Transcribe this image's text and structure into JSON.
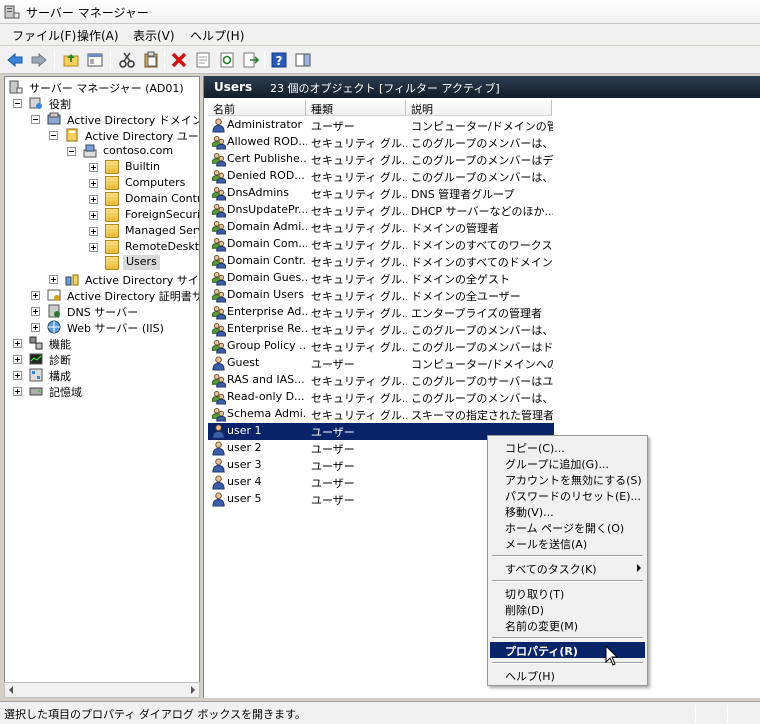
{
  "window": {
    "title": "サーバー マネージャー"
  },
  "menu": [
    {
      "label": "ファイル(F)"
    },
    {
      "label": "操作(A)"
    },
    {
      "label": "表示(V)"
    },
    {
      "label": "ヘルプ(H)"
    }
  ],
  "tree": [
    {
      "label": "サーバー マネージャー (AD01)",
      "icon": "server-manager-icon"
    },
    {
      "label": "役割",
      "icon": "roles-icon"
    },
    {
      "label": "Active Directory ドメイン サービス",
      "icon": "ad-domain-services-icon"
    },
    {
      "label": "Active Directory ユーザーとコンピューター",
      "icon": "ad-users-computers-icon"
    },
    {
      "label": "contoso.com",
      "icon": "domain-icon"
    },
    {
      "label": "Builtin",
      "icon": "folder-icon"
    },
    {
      "label": "Computers",
      "icon": "folder-icon"
    },
    {
      "label": "Domain Controllers",
      "icon": "ou-folder-icon"
    },
    {
      "label": "ForeignSecurityPrincipals",
      "icon": "folder-icon"
    },
    {
      "label": "Managed Service Accounts",
      "icon": "folder-icon"
    },
    {
      "label": "RemoteDesktop",
      "icon": "ou-folder-icon"
    },
    {
      "label": "Users",
      "icon": "folder-icon"
    },
    {
      "label": "Active Directory サイトとサービス",
      "icon": "ad-sites-icon"
    },
    {
      "label": "Active Directory 証明書サービス",
      "icon": "certificate-icon"
    },
    {
      "label": "DNS サーバー",
      "icon": "dns-icon"
    },
    {
      "label": "Web サーバー (IIS)",
      "icon": "iis-icon"
    },
    {
      "label": "機能",
      "icon": "features-icon"
    },
    {
      "label": "診断",
      "icon": "diagnostics-icon"
    },
    {
      "label": "構成",
      "icon": "configuration-icon"
    },
    {
      "label": "記憶域",
      "icon": "storage-icon"
    }
  ],
  "right": {
    "title": "Users",
    "info": "23 個のオブジェクト [フィルター アクティブ]",
    "columns": [
      "名前",
      "種類",
      "説明"
    ],
    "rows": [
      {
        "name": "Administrator",
        "type": "ユーザー",
        "desc": "コンピューター/ドメインの管...",
        "kind": "user"
      },
      {
        "name": "Allowed ROD...",
        "type": "セキュリティ グル...",
        "desc": "このグループのメンバーは、ド...",
        "kind": "group"
      },
      {
        "name": "Cert Publishe...",
        "type": "セキュリティ グル...",
        "desc": "このグループのメンバーはディ...",
        "kind": "group"
      },
      {
        "name": "Denied ROD...",
        "type": "セキュリティ グル...",
        "desc": "このグループのメンバーは、ド...",
        "kind": "group"
      },
      {
        "name": "DnsAdmins",
        "type": "セキュリティ グル...",
        "desc": "DNS 管理者グループ",
        "kind": "group"
      },
      {
        "name": "DnsUpdatePr...",
        "type": "セキュリティ グル...",
        "desc": "DHCP サーバーなどのほか...",
        "kind": "group"
      },
      {
        "name": "Domain Admi...",
        "type": "セキュリティ グル...",
        "desc": "ドメインの管理者",
        "kind": "group"
      },
      {
        "name": "Domain Com...",
        "type": "セキュリティ グル...",
        "desc": "ドメインのすべてのワークステ...",
        "kind": "group"
      },
      {
        "name": "Domain Contr...",
        "type": "セキュリティ グル...",
        "desc": "ドメインのすべてのドメイン コ...",
        "kind": "group"
      },
      {
        "name": "Domain Gues...",
        "type": "セキュリティ グル...",
        "desc": "ドメインの全ゲスト",
        "kind": "group"
      },
      {
        "name": "Domain Users",
        "type": "セキュリティ グル...",
        "desc": "ドメインの全ユーザー",
        "kind": "group"
      },
      {
        "name": "Enterprise Ad...",
        "type": "セキュリティ グル...",
        "desc": "エンタープライズの管理者",
        "kind": "group"
      },
      {
        "name": "Enterprise Re...",
        "type": "セキュリティ グル...",
        "desc": "このグループのメンバーは、エ...",
        "kind": "group"
      },
      {
        "name": "Group Policy ...",
        "type": "セキュリティ グル...",
        "desc": "このグループのメンバーはドメ...",
        "kind": "group"
      },
      {
        "name": "Guest",
        "type": "ユーザー",
        "desc": "コンピューター/ドメインへの...",
        "kind": "user"
      },
      {
        "name": "RAS and IAS...",
        "type": "セキュリティ グル...",
        "desc": "このグループのサーバーはユ...",
        "kind": "group"
      },
      {
        "name": "Read-only D...",
        "type": "セキュリティ グル...",
        "desc": "このグループのメンバーは、ド...",
        "kind": "group"
      },
      {
        "name": "Schema Admi...",
        "type": "セキュリティ グル...",
        "desc": "スキーマの指定された管理者",
        "kind": "group"
      },
      {
        "name": "user 1",
        "type": "ユーザー",
        "desc": "",
        "kind": "user"
      },
      {
        "name": "user 2",
        "type": "ユーザー",
        "desc": "",
        "kind": "user"
      },
      {
        "name": "user 3",
        "type": "ユーザー",
        "desc": "",
        "kind": "user"
      },
      {
        "name": "user 4",
        "type": "ユーザー",
        "desc": "",
        "kind": "user"
      },
      {
        "name": "user 5",
        "type": "ユーザー",
        "desc": "",
        "kind": "user"
      }
    ],
    "selected_index": 18
  },
  "context_menu": [
    {
      "label": "コピー(C)..."
    },
    {
      "label": "グループに追加(G)..."
    },
    {
      "label": "アカウントを無効にする(S)"
    },
    {
      "label": "パスワードのリセット(E)..."
    },
    {
      "label": "移動(V)..."
    },
    {
      "label": "ホーム ページを開く(O)"
    },
    {
      "label": "メールを送信(A)"
    },
    {
      "label": "すべてのタスク(K)"
    },
    {
      "label": "切り取り(T)"
    },
    {
      "label": "削除(D)"
    },
    {
      "label": "名前の変更(M)"
    },
    {
      "label": "プロパティ(R)"
    },
    {
      "label": "ヘルプ(H)"
    }
  ],
  "status": {
    "text": "選択した項目のプロパティ ダイアログ ボックスを開きます。"
  },
  "colors": {
    "header": "#1b2838",
    "selection": "#0a246a"
  }
}
